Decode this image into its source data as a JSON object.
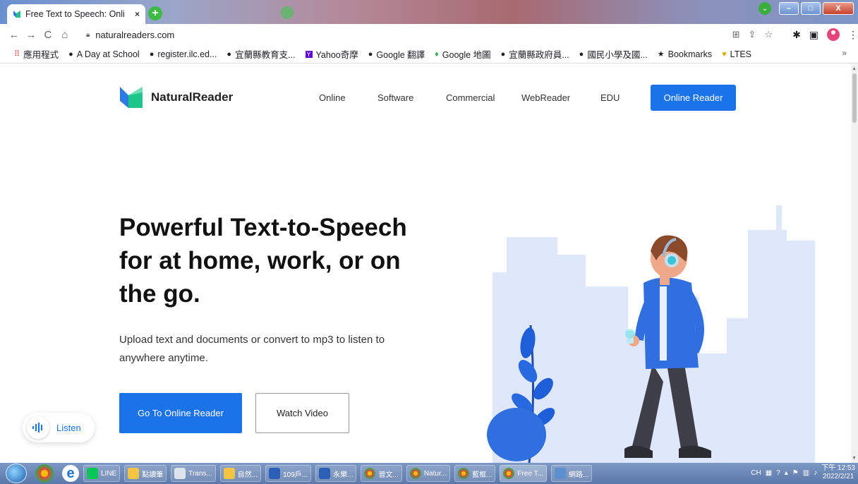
{
  "browser": {
    "active_tab_title": "Free Text to Speech: Onli",
    "tab_close": "×",
    "new_tab": "+",
    "url": "naturalreaders.com",
    "bookmarks": [
      {
        "label": "應用程式",
        "icon": "apps-grid-icon"
      },
      {
        "label": "A Day at School",
        "icon": "globe-icon"
      },
      {
        "label": "register.ilc.ed...",
        "icon": "globe-icon"
      },
      {
        "label": "宜蘭縣教育支...",
        "icon": "globe-icon"
      },
      {
        "label": "Yahoo奇摩",
        "icon": "yahoo-icon"
      },
      {
        "label": "Google 翻譯",
        "icon": "globe-icon"
      },
      {
        "label": "Google 地圖",
        "icon": "maps-pin-icon"
      },
      {
        "label": "宜蘭縣政府員...",
        "icon": "globe-icon"
      },
      {
        "label": "國民小學及國...",
        "icon": "globe-icon"
      },
      {
        "label": "Bookmarks",
        "icon": "star-icon"
      },
      {
        "label": "LTES",
        "icon": "ltes-icon"
      }
    ],
    "bookmarks_more": "»"
  },
  "site": {
    "brand": "NaturalReader",
    "nav": [
      "Online",
      "Software",
      "Commercial",
      "WebReader",
      "EDU"
    ],
    "cta_top": "Online Reader",
    "hero_title": "Powerful Text-to-Speech for at home, work, or on the go.",
    "hero_subtitle": "Upload text and documents or convert to mp3 to listen to anywhere anytime.",
    "primary_button": "Go To Online Reader",
    "secondary_button": "Watch Video",
    "listen_label": "Listen",
    "accent_color": "#1a73e8"
  },
  "taskbar": {
    "items": [
      "LINE",
      "點讀筆",
      "Trans...",
      "自然...",
      "109戶...",
      "永樂...",
      "晉文...",
      "Natur...",
      "藍框...",
      "Free T...",
      "網路..."
    ],
    "tray_lang": "CH",
    "clock_time": "下午 12:53",
    "clock_date": "2022/2/21"
  }
}
